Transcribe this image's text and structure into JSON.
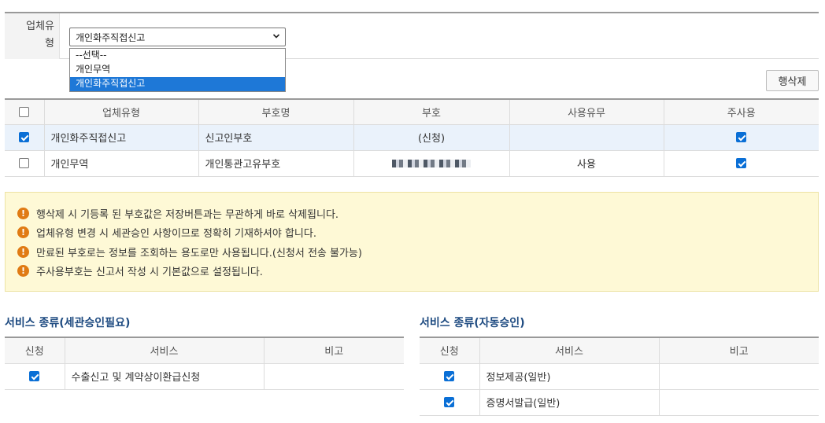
{
  "company_type": {
    "label_line1": "업체유",
    "label_line2": "형",
    "selected": "개인화주직접신고",
    "options": [
      "--선택--",
      "개인무역",
      "개인화주직접신고"
    ]
  },
  "delete_button": "행삭제",
  "main_table": {
    "headers": [
      "업체유형",
      "부호명",
      "부호",
      "사용유무",
      "주사용"
    ],
    "rows": [
      {
        "checked": true,
        "type": "개인화주직접신고",
        "code_name": "신고인부호",
        "code": "(신청)",
        "in_use": "",
        "primary": true
      },
      {
        "checked": false,
        "type": "개인무역",
        "code_name": "개인통관고유부호",
        "code": "",
        "in_use": "사용",
        "primary": true
      }
    ]
  },
  "notices": [
    "행삭제 시 기등록 된 부호값은 저장버튼과는 무관하게 바로 삭제됩니다.",
    "업체유형 변경 시 세관승인 사항이므로 정확히 기재하셔야 합니다.",
    "만료된 부호로는 정보를 조회하는 용도로만 사용됩니다.(신청서 전송 불가능)",
    "주사용부호는 신고서 작성 시 기본값으로 설정됩니다."
  ],
  "services_customs": {
    "title": "서비스 종류(세관승인필요)",
    "headers": [
      "신청",
      "서비스",
      "비고"
    ],
    "rows": [
      {
        "checked": true,
        "service": "수출신고 및 계약상이환급신청",
        "note": ""
      }
    ]
  },
  "services_auto": {
    "title": "서비스 종류(자동승인)",
    "headers": [
      "신청",
      "서비스",
      "비고"
    ],
    "rows": [
      {
        "checked": true,
        "service": "정보제공(일반)",
        "note": ""
      },
      {
        "checked": true,
        "service": "증명서발급(일반)",
        "note": ""
      }
    ]
  },
  "colors": {
    "accent": "#1e78d7",
    "title": "#1d4a80",
    "notice_bg": "#fef9d6",
    "warn": "#e07b14"
  },
  "icons": [
    "warning-icon",
    "chevron-down-icon",
    "checkbox-icon"
  ]
}
